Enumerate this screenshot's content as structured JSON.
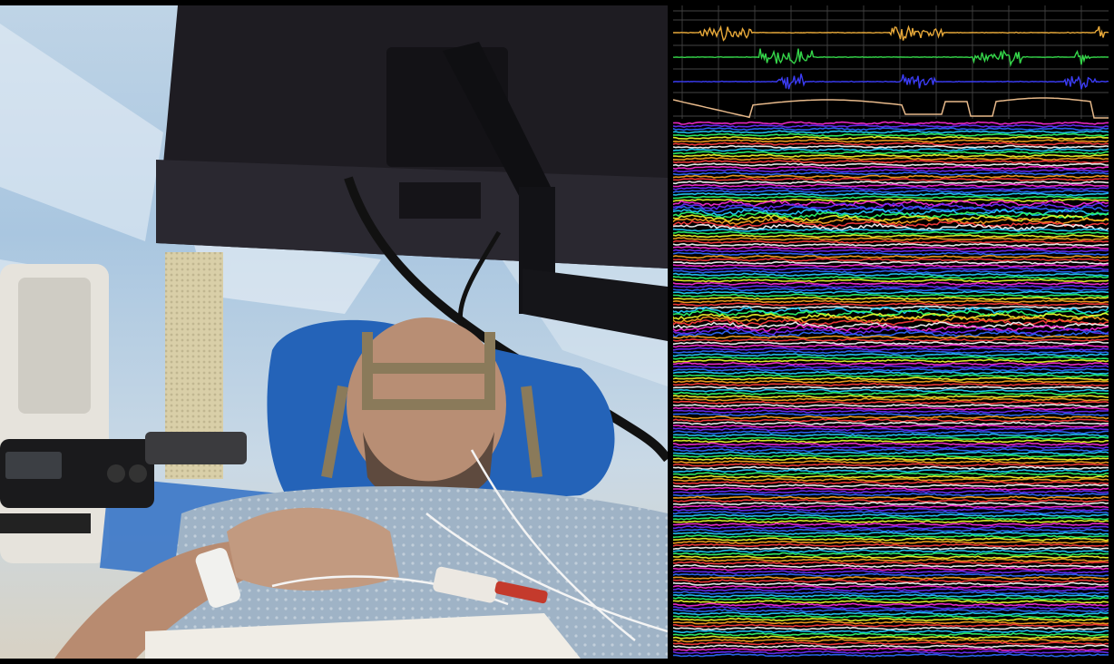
{
  "scene": {
    "left_panel": "photo-operating-room",
    "right_panel": "neural-signal-display"
  },
  "audio_traces": [
    {
      "color": "#e8a93a",
      "bursts": [
        [
          0.06,
          0.18
        ],
        [
          0.5,
          0.62
        ],
        [
          0.97,
          0.99
        ]
      ]
    },
    {
      "color": "#35d64a",
      "bursts": [
        [
          0.2,
          0.32
        ],
        [
          0.69,
          0.8
        ],
        [
          0.92,
          0.96
        ]
      ]
    },
    {
      "color": "#3b3cf5",
      "bursts": [
        [
          0.24,
          0.3
        ],
        [
          0.52,
          0.6
        ],
        [
          0.9,
          0.97
        ]
      ]
    }
  ],
  "envelope_color": "#e7b98a",
  "band_palette": [
    "#ff2bd6",
    "#6a2cff",
    "#2b6bff",
    "#20d0ff",
    "#2bff6a",
    "#f2ff2b",
    "#ffa51f",
    "#ff3b3b",
    "#ffffff"
  ],
  "band_count": 20
}
